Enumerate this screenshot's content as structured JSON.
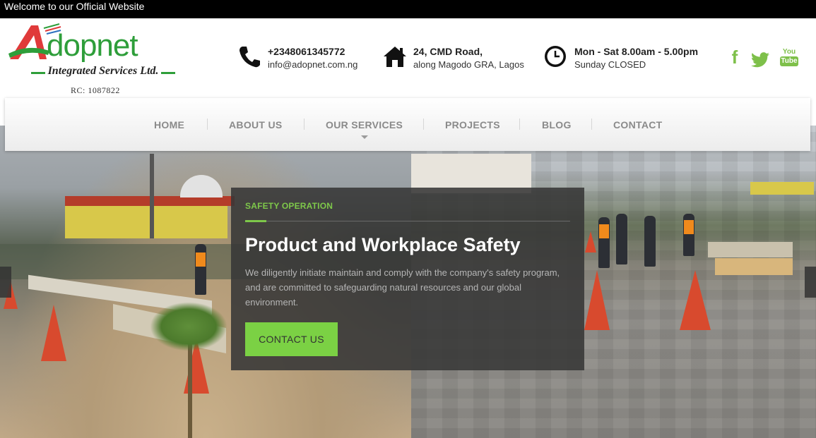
{
  "topbar": {
    "text": "Welcome to our Official Website"
  },
  "logo": {
    "letter": "A",
    "word": "dopnet",
    "subtitle": "Integrated Services Ltd.",
    "rc": "RC: 1087822"
  },
  "contact": [
    {
      "icon": "phone-icon",
      "line1": "+2348061345772",
      "line2": "info@adopnet.com.ng"
    },
    {
      "icon": "home-icon",
      "line1": "24, CMD Road,",
      "line2": "along Magodo GRA, Lagos"
    },
    {
      "icon": "clock-icon",
      "line1": "Mon - Sat 8.00am - 5.00pm",
      "line2": "Sunday CLOSED"
    }
  ],
  "social": {
    "facebook": "f",
    "youtube_top": "You",
    "youtube_bottom": "Tube"
  },
  "nav": {
    "items": [
      {
        "label": "HOME"
      },
      {
        "label": "ABOUT US"
      },
      {
        "label": "OUR SERVICES"
      },
      {
        "label": "PROJECTS"
      },
      {
        "label": "BLOG"
      },
      {
        "label": "CONTACT"
      }
    ]
  },
  "hero": {
    "kicker": "SAFETY OPERATION",
    "title": "Product and Workplace Safety",
    "text": "We diligently initiate maintain and comply with the company's safety program, and are committed to safeguarding natural resources and our global environment.",
    "button": "CONTACT US"
  },
  "colors": {
    "accent": "#7bd144",
    "brand_green": "#2e9e3a",
    "brand_red": "#e03a3a",
    "topbar": "#000000"
  }
}
